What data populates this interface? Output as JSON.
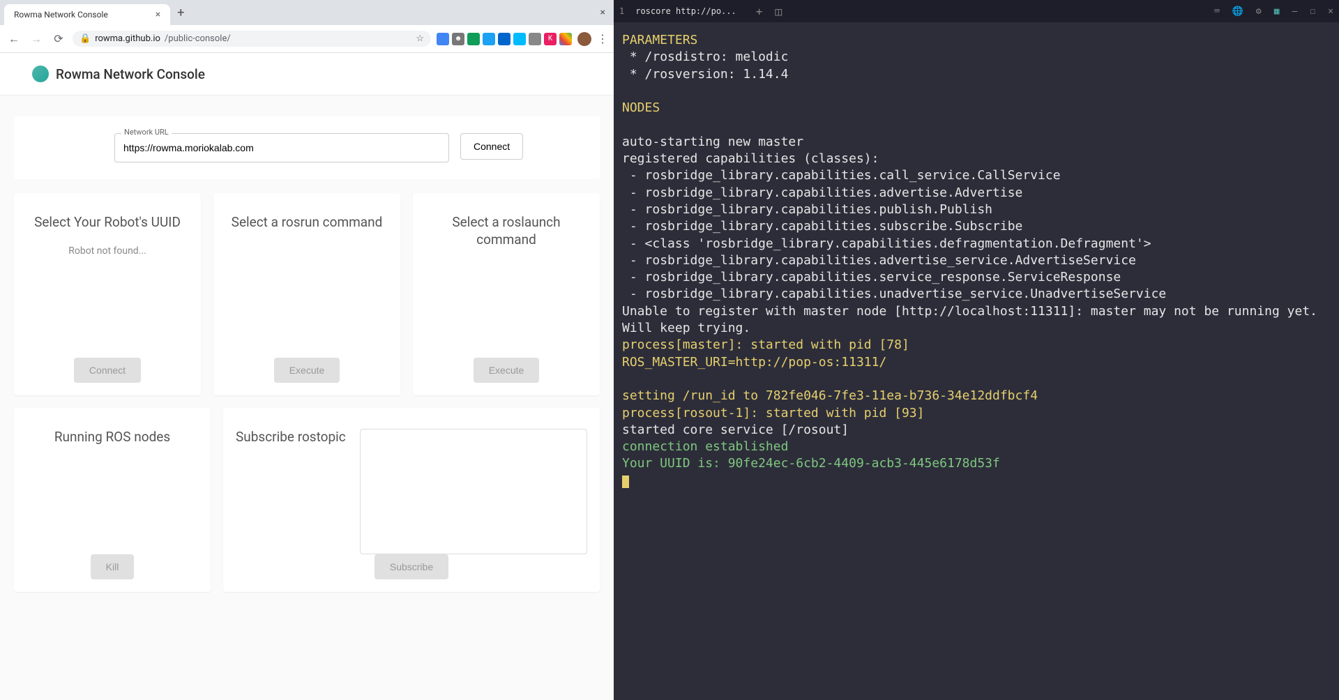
{
  "browser": {
    "tab_title": "Rowma Network Console",
    "url_host": "rowma.github.io",
    "url_path": "/public-console/",
    "header_title": "Rowma Network Console",
    "network_url_label": "Network URL",
    "network_url_value": "https://rowma.moriokalab.com",
    "connect_btn": "Connect",
    "cards": {
      "uuid": {
        "title": "Select Your Robot's UUID",
        "msg": "Robot not found...",
        "btn": "Connect"
      },
      "rosrun": {
        "title": "Select a rosrun command",
        "btn": "Execute"
      },
      "roslaunch": {
        "title": "Select a roslaunch command",
        "btn": "Execute"
      },
      "nodes": {
        "title": "Running ROS nodes",
        "btn": "Kill"
      },
      "subscribe": {
        "title": "Subscribe rostopic",
        "btn": "Subscribe"
      }
    }
  },
  "terminal": {
    "tab_num": "1",
    "tab_title": "roscore http://po...",
    "lines": {
      "l0": "PARAMETERS",
      "l1": " * /rosdistro: melodic",
      "l2": " * /rosversion: 1.14.4",
      "l3": "",
      "l4": "NODES",
      "l5": "",
      "l6": "auto-starting new master",
      "l7": "registered capabilities (classes):",
      "l8": " - rosbridge_library.capabilities.call_service.CallService",
      "l9": " - rosbridge_library.capabilities.advertise.Advertise",
      "l10": " - rosbridge_library.capabilities.publish.Publish",
      "l11": " - rosbridge_library.capabilities.subscribe.Subscribe",
      "l12": " - <class 'rosbridge_library.capabilities.defragmentation.Defragment'>",
      "l13": " - rosbridge_library.capabilities.advertise_service.AdvertiseService",
      "l14": " - rosbridge_library.capabilities.service_response.ServiceResponse",
      "l15": " - rosbridge_library.capabilities.unadvertise_service.UnadvertiseService",
      "l16": "Unable to register with master node [http://localhost:11311]: master may not be running yet. Will keep trying.",
      "l17": "process[master]: started with pid [78]",
      "l18": "ROS_MASTER_URI=http://pop-os:11311/",
      "l19": "",
      "l20": "setting /run_id to 782fe046-7fe3-11ea-b736-34e12ddfbcf4",
      "l21": "process[rosout-1]: started with pid [93]",
      "l22": "started core service [/rosout]",
      "l23": "connection established",
      "l24": "Your UUID is: 90fe24ec-6cb2-4409-acb3-445e6178d53f"
    }
  }
}
